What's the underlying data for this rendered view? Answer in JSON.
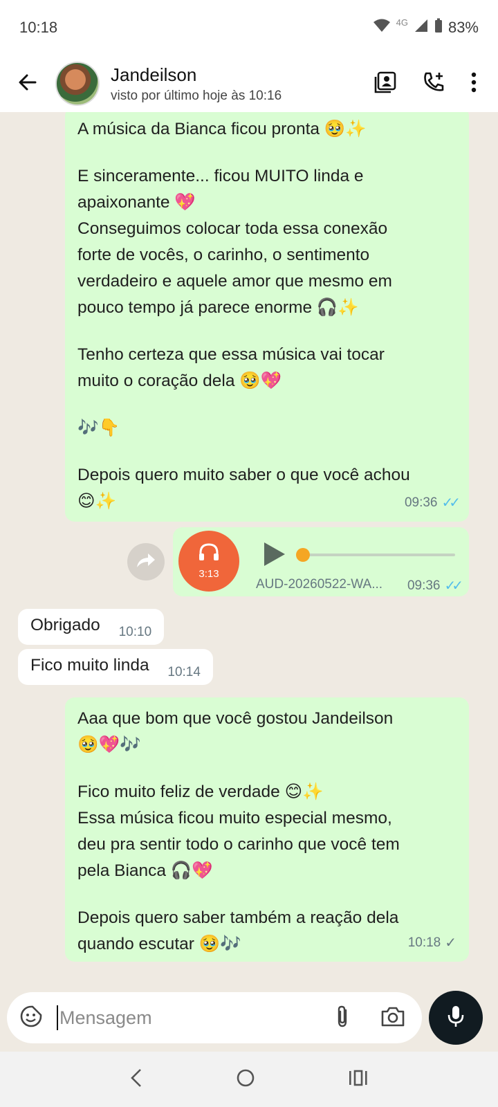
{
  "status_bar": {
    "time": "10:18",
    "network": "4G",
    "battery": "83%"
  },
  "header": {
    "contact_name": "Jandeilson",
    "contact_status": "visto por último hoje às 10:16",
    "icons": [
      "back-arrow-icon",
      "contact-card-icon",
      "add-call-icon",
      "more-vert-icon"
    ]
  },
  "messages": {
    "m1": {
      "lines": [
        "A música da Bianca ficou pronta 🥹✨",
        "",
        "E sinceramente... ficou MUITO linda e",
        "apaixonante 💖",
        "Conseguimos colocar toda essa conexão",
        "forte de vocês, o carinho, o sentimento",
        "verdadeiro e aquele amor que mesmo em",
        "pouco tempo já parece enorme 🎧✨",
        "",
        "Tenho certeza que essa música vai tocar",
        "muito o coração dela 🥹💖",
        "",
        "🎶👇",
        "",
        "Depois quero muito saber o que você achou",
        "😊✨"
      ],
      "time": "09:36",
      "ticks": "✓✓"
    },
    "audio": {
      "duration": "3:13",
      "filename": "AUD-20260522-WA...",
      "time": "09:36",
      "ticks": "✓✓",
      "progress": 0
    },
    "m2": {
      "text": "Obrigado",
      "time": "10:10"
    },
    "m3": {
      "text": "Fico muito linda",
      "time": "10:14"
    },
    "m4": {
      "lines": [
        "Aaa que bom que você gostou Jandeilson",
        "🥹💖🎶",
        "",
        "Fico muito feliz de verdade 😊✨",
        "Essa música ficou muito especial mesmo,",
        "deu pra sentir todo o carinho que você tem",
        "pela Bianca 🎧💖",
        "",
        "Depois quero saber também a reação dela",
        "quando escutar 🥹🎶"
      ],
      "time": "10:18",
      "ticks": "✓"
    }
  },
  "composer": {
    "placeholder": "Mensagem"
  },
  "colors": {
    "outgoing_bubble": "#d9fdd3",
    "incoming_bubble": "#ffffff",
    "read_ticks": "#53bdeb",
    "audio_thumb": "#f0663a"
  }
}
